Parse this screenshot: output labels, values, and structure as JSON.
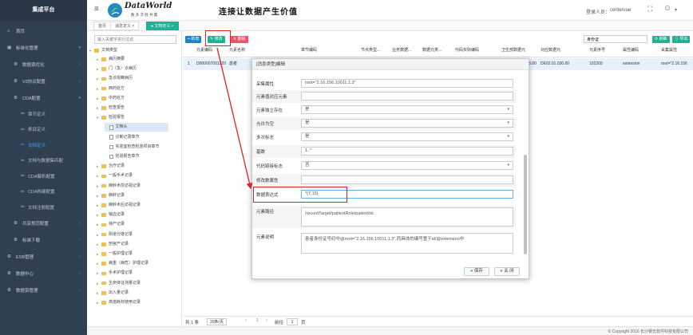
{
  "app": {
    "title": "集成平台",
    "logo_text": "DataWorld",
    "logo_sub": "数 多 济 胜 共 赢",
    "slogan": "连接让数据产生价值",
    "user_label": "登录人员：",
    "user_name": "centervue"
  },
  "sidebar": {
    "items": [
      {
        "label": "首页"
      },
      {
        "label": "标准化管理"
      },
      {
        "label": "数据源优化"
      },
      {
        "label": "V3协议配置"
      },
      {
        "label": "CDA配置"
      },
      {
        "label": "共享规范配置"
      },
      {
        "label": "标准下载"
      },
      {
        "label": "ESB管理"
      },
      {
        "label": "数据中心"
      },
      {
        "label": "数据资管理"
      }
    ],
    "subitems": [
      {
        "label": "章节定义"
      },
      {
        "label": "条目定义"
      },
      {
        "label": "文档定义"
      },
      {
        "label": "文档与数据集匹配"
      },
      {
        "label": "CDA解析配置"
      },
      {
        "label": "CDA构建配置"
      },
      {
        "label": "文档注册配置"
      }
    ]
  },
  "tabs": [
    {
      "label": "首页"
    },
    {
      "label": "消息定义 ×"
    },
    {
      "label": "● 文档定义 ×"
    }
  ],
  "tree": {
    "search_placeholder": "输入关键字进行过滤",
    "root": "文档类型",
    "nodes": [
      {
        "label": "病历摘要"
      },
      {
        "label": "门（急）诊病历"
      },
      {
        "label": "急诊观察病历"
      },
      {
        "label": "西药处方"
      },
      {
        "label": "中药处方"
      },
      {
        "label": "检查报告"
      },
      {
        "label": "检验报告"
      },
      {
        "label": "文档头"
      },
      {
        "label": "诊断记录章节"
      },
      {
        "label": "实验室检查检验项目章节"
      },
      {
        "label": "检验报告章节"
      },
      {
        "label": "治疗记录"
      },
      {
        "label": "一般手术记录"
      },
      {
        "label": "麻醉术前访视记录"
      },
      {
        "label": "麻醉记录"
      },
      {
        "label": "麻醉术后访视记录"
      },
      {
        "label": "输血记录"
      },
      {
        "label": "待产记录"
      },
      {
        "label": "阴道分娩记录"
      },
      {
        "label": "剖宫产记录"
      },
      {
        "label": "一般护理记录"
      },
      {
        "label": "病重（病危）护理记录"
      },
      {
        "label": "手术护理记录"
      },
      {
        "label": "生命体征测量记录"
      },
      {
        "label": "出入量记录"
      },
      {
        "label": "高值耗材使用记录"
      }
    ]
  },
  "toolbar": {
    "add": "+ 新增",
    "edit": "✎ 修改",
    "delete": "✕ 删除",
    "search_value": "身份证",
    "refresh": "刷新",
    "export": "导出"
  },
  "grid": {
    "headers": [
      "元素编码",
      "元素名称",
      "章节编码",
      "节点类型...",
      "业务数据...",
      "数据元类...",
      "代码实际编码",
      "卫生部数据元",
      "对应数据元",
      "元素序号",
      "属性编码",
      "采集属性"
    ],
    "row": [
      "1",
      "D000007001220",
      "患者",
      "",
      "",
      "",
      "",
      "",
      "3.00",
      "DE02.01.030.00",
      "102200",
      "extension",
      "root=\"2.16.156"
    ]
  },
  "modal": {
    "title": "[消息类型]编辑",
    "fields": [
      {
        "label": "采集属性",
        "value": "root=\"2.16.156.10011.1.3\""
      },
      {
        "label": "元素值对应元素",
        "value": ""
      },
      {
        "label": "元素独立存在",
        "value": "是"
      },
      {
        "label": "允许为空",
        "value": "是"
      },
      {
        "label": "多次标志",
        "value": "是"
      },
      {
        "label": "基数",
        "value": "1..*"
      },
      {
        "label": "代码链接标志",
        "value": "否"
      },
      {
        "label": "修改数属性",
        "value": ""
      },
      {
        "label": "数据表达式",
        "value": "*{7,15}"
      },
      {
        "label": "元素路径",
        "value": "/recordTarget/patientRole/patient/id"
      },
      {
        "label": "元素说明",
        "value": "患者身份证号码中@root=\"2.16.156.10011.1.3\",而具体的编号置于id/@extension中"
      }
    ],
    "save": "保存",
    "close": "关 闭"
  },
  "footer": {
    "total": "共 1 条",
    "page_size": "20条/页",
    "goto": "前往",
    "page": "1",
    "page_unit": "页"
  },
  "copyright": "© Copyright 2016 长沙赛氏软件科技有限公司"
}
